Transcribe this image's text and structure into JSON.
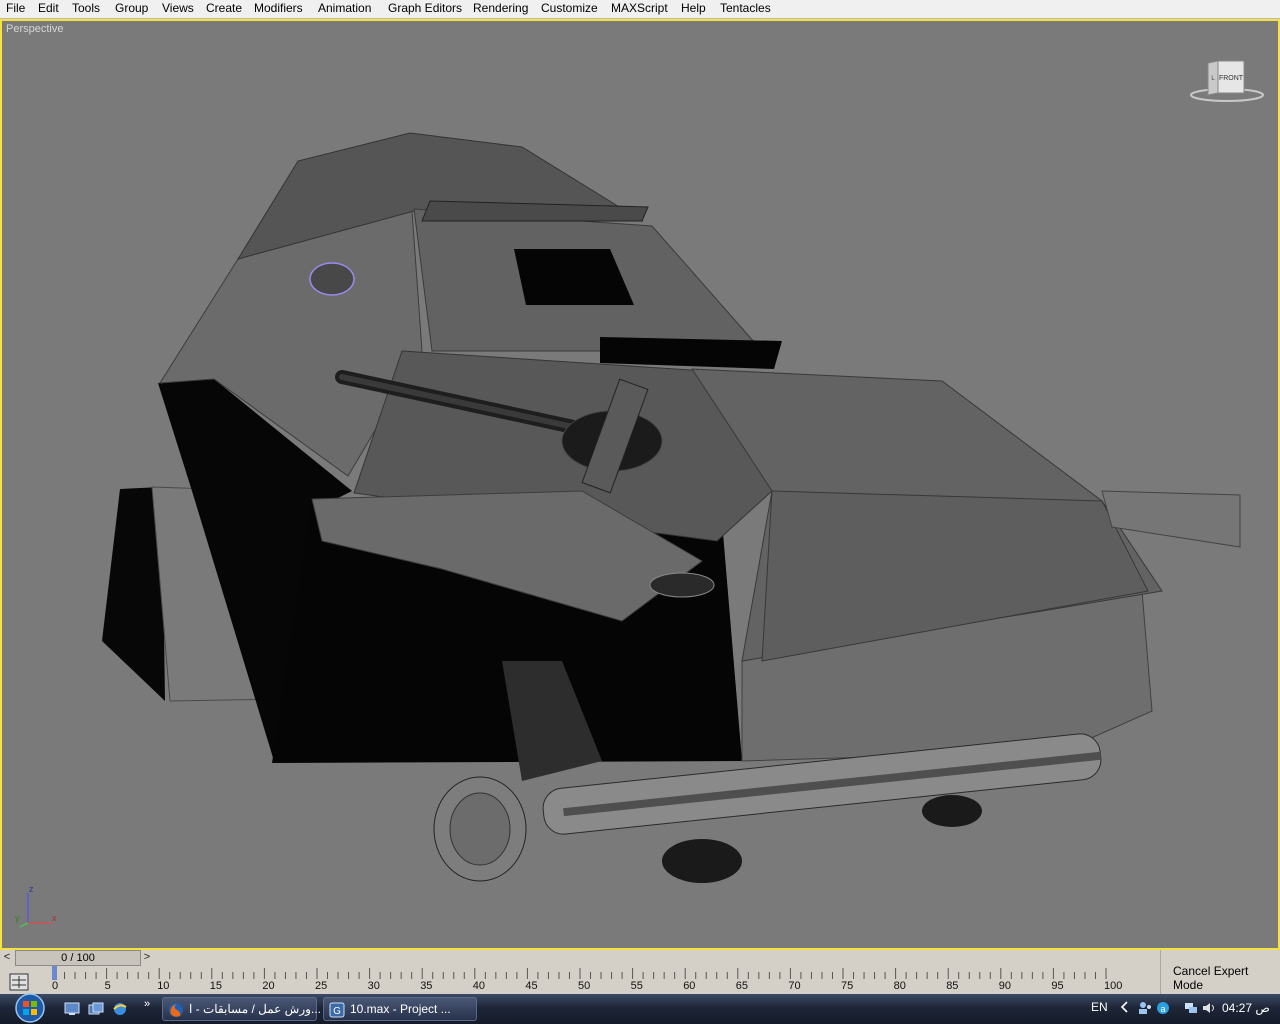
{
  "menu": {
    "items": [
      {
        "label": "File"
      },
      {
        "label": "Edit"
      },
      {
        "label": "Tools"
      },
      {
        "label": "Group"
      },
      {
        "label": "Views"
      },
      {
        "label": "Create"
      },
      {
        "label": "Modifiers"
      },
      {
        "label": "Animation"
      },
      {
        "label": "Graph Editors"
      },
      {
        "label": "Rendering"
      },
      {
        "label": "Customize"
      },
      {
        "label": "MAXScript"
      },
      {
        "label": "Help"
      },
      {
        "label": "Tentacles"
      }
    ]
  },
  "viewport": {
    "label": "Perspective",
    "active_border_color": "#f5e33b",
    "background_color": "#7a7a7a",
    "viewcube": {
      "face_label": "FRONT",
      "side_label": "L"
    },
    "axis": {
      "x": "x",
      "y": "y",
      "z": "z"
    }
  },
  "timeslider": {
    "position": "0 / 100",
    "prev_label": "<",
    "next_label": ">"
  },
  "trackbar": {
    "ticks": [
      "0",
      "5",
      "10",
      "15",
      "20",
      "25",
      "30",
      "35",
      "40",
      "45",
      "50",
      "55",
      "60",
      "65",
      "70",
      "75",
      "80",
      "85",
      "90",
      "95",
      "100"
    ]
  },
  "expert": {
    "button_label": "Cancel Expert Mode"
  },
  "taskbar": {
    "quicklaunch_more": "»",
    "tasks": [
      {
        "label": "ورش عمل / مسابقات - ا...",
        "icon": "firefox-icon"
      },
      {
        "label": "10.max     - Project ...",
        "icon": "3dsmax-icon"
      }
    ],
    "tray": {
      "language": "EN",
      "clock": "04:27 ص"
    }
  }
}
